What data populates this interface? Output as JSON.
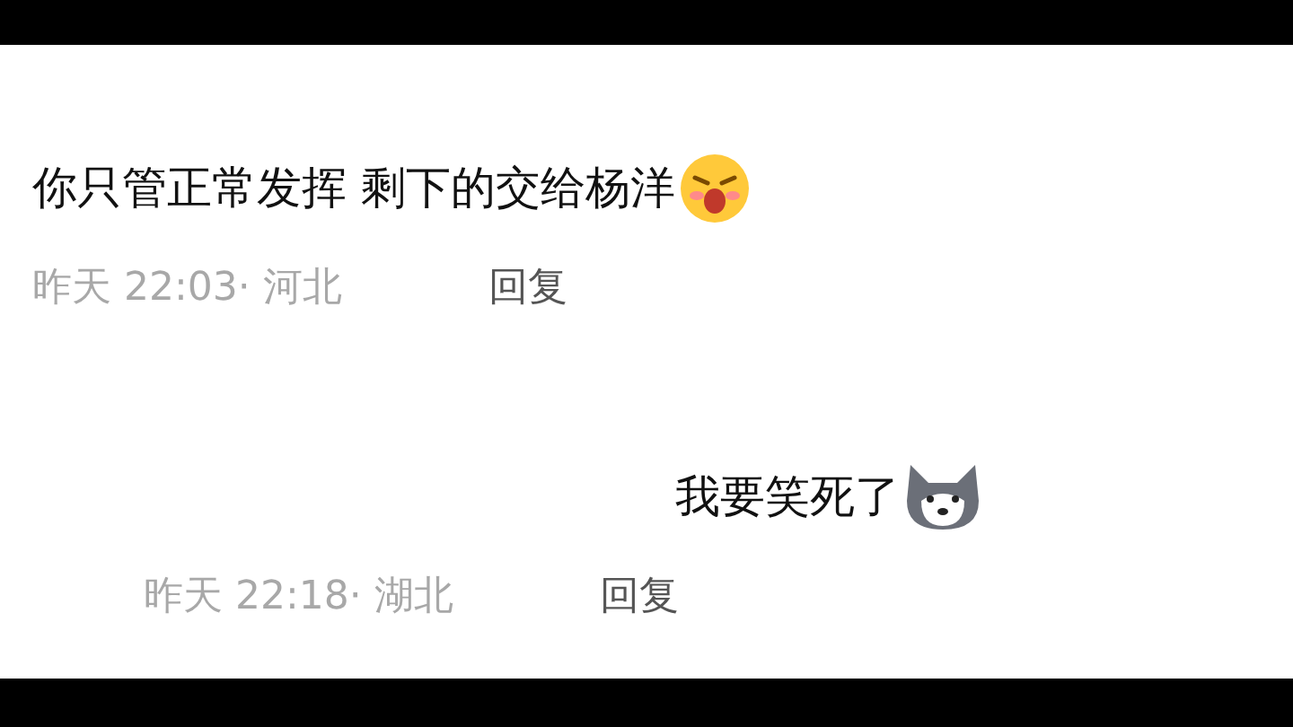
{
  "comments": [
    {
      "text": "你只管正常发挥 剩下的交给杨洋",
      "kind": "face",
      "time": "昨天 22:03· 河北",
      "reply": "回复"
    },
    {
      "text": "我要笑死了",
      "kind": "husky",
      "time": "昨天 22:18· 湖北",
      "reply": "回复"
    }
  ]
}
